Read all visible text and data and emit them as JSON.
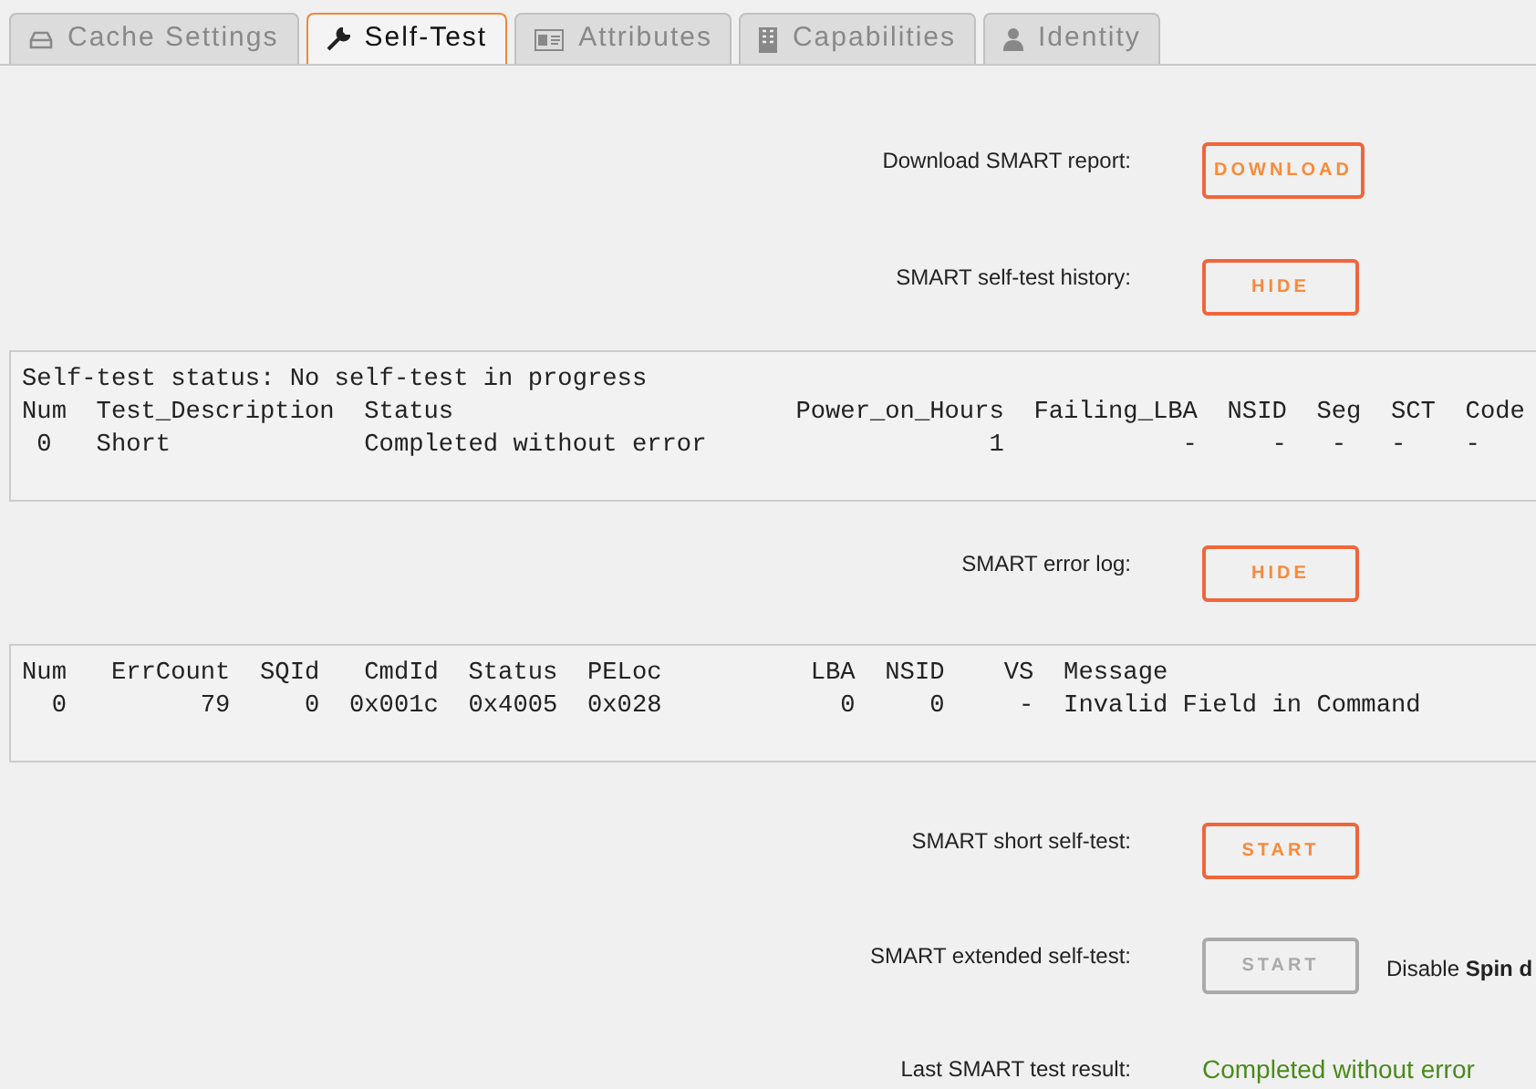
{
  "tabs": [
    {
      "label": "Cache Settings",
      "selected": false
    },
    {
      "label": "Self-Test",
      "selected": true
    },
    {
      "label": "Attributes",
      "selected": false
    },
    {
      "label": "Capabilities",
      "selected": false
    },
    {
      "label": "Identity",
      "selected": false
    }
  ],
  "sections": [
    {
      "kind": "control",
      "label": "Download SMART report:",
      "button": "DOWNLOAD",
      "disabled": false
    },
    {
      "kind": "control",
      "label": "SMART self-test history:",
      "button": "HIDE",
      "disabled": false
    },
    {
      "kind": "log",
      "lines": [
        "Self-test status: No self-test in progress",
        "Num  Test_Description  Status                       Power_on_Hours  Failing_LBA  NSID  Seg  SCT  Code",
        " 0   Short             Completed without error                   1            -     -   -   -    -"
      ]
    },
    {
      "kind": "control",
      "label": "SMART error log:",
      "button": "HIDE",
      "disabled": false
    },
    {
      "kind": "log",
      "lines": [
        "Num   ErrCount  SQId   CmdId  Status  PELoc          LBA  NSID    VS  Message",
        "  0         79     0  0x001c  0x4005  0x028            0     0     -  Invalid Field in Command"
      ]
    },
    {
      "kind": "control",
      "label": "SMART short self-test:",
      "button": "START",
      "disabled": false
    },
    {
      "kind": "control",
      "label": "SMART extended self-test:",
      "button": "START",
      "disabled": true,
      "note": "Disable **Spin d**"
    },
    {
      "kind": "result",
      "label": "Last SMART test result:",
      "value": "Completed without error"
    }
  ]
}
